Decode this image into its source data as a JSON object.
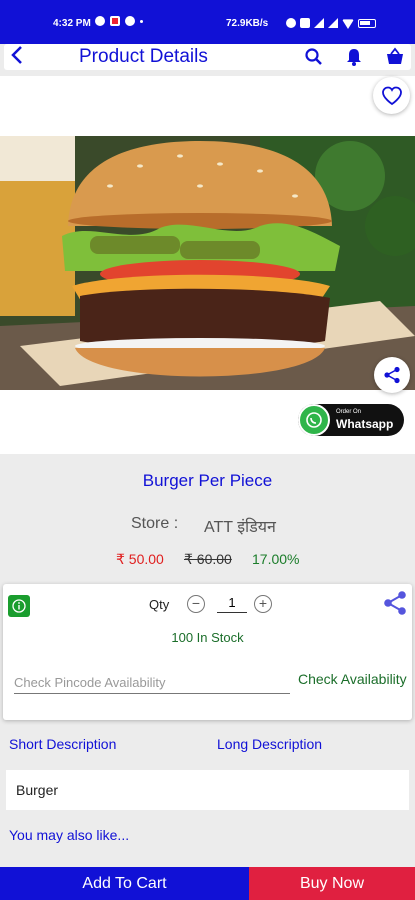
{
  "status_bar": {
    "time": "4:32 PM",
    "network_speed": "72.9KB/s",
    "battery": "battery-icon"
  },
  "app_bar": {
    "title": "Product Details",
    "icons": [
      "back-arrow-icon",
      "search-icon",
      "bell-icon",
      "basket-icon"
    ]
  },
  "product": {
    "name": "Burger Per Piece",
    "store_label": "Store :",
    "store_name": "ATT इंडियन",
    "price": "₹ 50.00",
    "mrp": "₹ 60.00",
    "discount": "17.00%",
    "whatsapp_small": "Order On",
    "whatsapp_big": "Whatsapp"
  },
  "stock_card": {
    "qty_label": "Qty",
    "qty_value": "1",
    "stock_text": "100 In Stock",
    "pincode_placeholder": "Check Pincode Availability",
    "check_button": "Check Availability"
  },
  "description": {
    "short_tab": "Short Description",
    "long_tab": "Long Description",
    "text": "Burger",
    "also_like": "You may also like..."
  },
  "actions": {
    "add_to_cart": "Add To Cart",
    "buy_now": "Buy Now"
  },
  "colors": {
    "primary": "#1111d6",
    "buy_now": "#e02040",
    "price": "#e02020",
    "discount": "#1b7d2a"
  }
}
